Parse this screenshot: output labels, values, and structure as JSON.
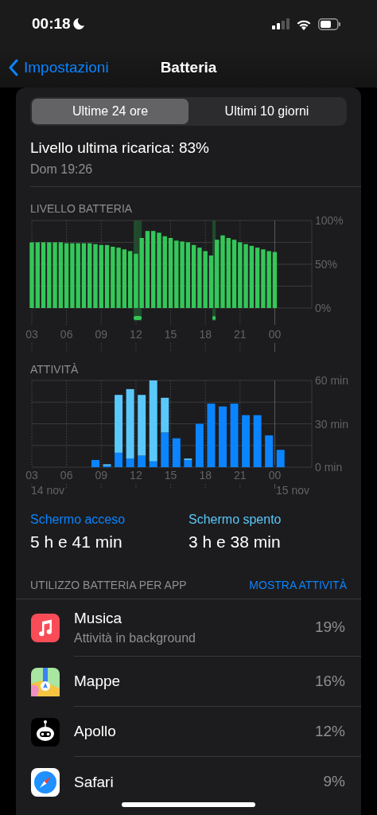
{
  "status_bar": {
    "time": "00:18",
    "focus_moon": true
  },
  "nav": {
    "back_label": "Impostazioni",
    "title": "Batteria"
  },
  "tabs": [
    {
      "label": "Ultime 24 ore",
      "selected": true
    },
    {
      "label": "Ultimi 10 giorni",
      "selected": false
    }
  ],
  "last_charge": {
    "text": "Livello ultima ricarica: 83%",
    "time": "Dom 19:26"
  },
  "battery_level": {
    "title": "LIVELLO BATTERIA",
    "chart_data": {
      "type": "bar",
      "x": [
        3,
        3.5,
        4,
        4.5,
        5,
        5.5,
        6,
        6.5,
        7,
        7.5,
        8,
        8.5,
        9,
        9.5,
        10,
        10.5,
        11,
        11.5,
        12,
        12.5,
        13,
        13.5,
        14,
        14.5,
        15,
        15.5,
        16,
        16.5,
        17,
        17.5,
        18,
        18.5,
        19,
        19.5,
        20,
        20.5,
        21,
        21.5,
        22,
        22.5,
        23,
        23.5,
        24
      ],
      "values": [
        75,
        75,
        75,
        75,
        75,
        75,
        74,
        74,
        74,
        74,
        74,
        73,
        72,
        72,
        70,
        69,
        67,
        65,
        62,
        80,
        88,
        88,
        86,
        82,
        80,
        77,
        76,
        75,
        72,
        69,
        65,
        60,
        78,
        83,
        80,
        78,
        75,
        73,
        71,
        69,
        67,
        65,
        64
      ],
      "color": "#34c759",
      "grid": true,
      "xlim": [
        3,
        27.2
      ],
      "ylim": [
        0,
        100
      ],
      "xticks": [
        {
          "value": 3,
          "label": "03"
        },
        {
          "value": 6,
          "label": "06"
        },
        {
          "value": 9,
          "label": "09"
        },
        {
          "value": 12,
          "label": "12"
        },
        {
          "value": 15,
          "label": "15"
        },
        {
          "value": 18,
          "label": "18"
        },
        {
          "value": 21,
          "label": "21"
        }
      ],
      "yticks": [
        {
          "value": 100,
          "label": "100%"
        },
        {
          "value": 50,
          "label": "50%"
        },
        {
          "value": 0,
          "label": "0%"
        }
      ],
      "bands": [
        {
          "axis": "x",
          "from": 11.8,
          "to": 12.5
        },
        {
          "axis": "x",
          "from": 18.6,
          "to": 18.9
        }
      ],
      "ref_lines": [
        {
          "axis": "x",
          "value": 24
        }
      ]
    },
    "midnight_label": "00"
  },
  "activity": {
    "title": "ATTIVITÀ",
    "chart_data": {
      "type": "bar",
      "stacked": true,
      "grid": true,
      "x": [
        8.5,
        9.5,
        10.5,
        11.5,
        12.5,
        13.5,
        14.5,
        15.5,
        16.5,
        17.5,
        18.5,
        19.5,
        20.5,
        21.5,
        22.5,
        23.5,
        24.5
      ],
      "series": [
        {
          "name": "Schermo acceso",
          "color": "#0a84ff",
          "values": [
            5,
            1,
            10,
            6,
            8,
            4,
            24,
            20,
            5,
            30,
            44,
            42,
            44,
            36,
            36,
            22,
            12
          ]
        },
        {
          "name": "Schermo spento",
          "color": "#5ac8fa",
          "values": [
            0,
            1,
            40,
            48,
            42,
            56,
            24,
            0,
            1,
            0,
            0,
            0,
            0,
            0,
            0,
            0,
            0
          ]
        }
      ],
      "xlim": [
        3,
        27.2
      ],
      "ylim": [
        0,
        60
      ],
      "xticks": [
        {
          "value": 3,
          "label": "03"
        },
        {
          "value": 6,
          "label": "06"
        },
        {
          "value": 9,
          "label": "09"
        },
        {
          "value": 12,
          "label": "12"
        },
        {
          "value": 15,
          "label": "15"
        },
        {
          "value": 18,
          "label": "18"
        },
        {
          "value": 21,
          "label": "21"
        }
      ],
      "yticks": [
        {
          "value": 60,
          "label": "60 min"
        },
        {
          "value": 30,
          "label": "30 min"
        },
        {
          "value": 0,
          "label": "0 min"
        }
      ],
      "ref_lines": [
        {
          "axis": "x",
          "value": 24
        }
      ]
    },
    "midnight_label": "00",
    "date_labels": [
      "14 nov",
      "15 nov"
    ]
  },
  "summary": [
    {
      "value": "5 h e 41 min"
    },
    {
      "value": "3 h e 38 min"
    }
  ],
  "app_usage": {
    "title": "UTILIZZO BATTERIA PER APP",
    "action": "MOSTRA ATTIVITÀ",
    "apps": [
      {
        "kind": "music",
        "name": "Musica",
        "detail": "Attività in background",
        "percent": "19%"
      },
      {
        "kind": "maps",
        "name": "Mappe",
        "percent": "16%"
      },
      {
        "kind": "apollo",
        "name": "Apollo",
        "percent": "12%"
      },
      {
        "kind": "safari",
        "name": "Safari",
        "percent": "9%"
      }
    ]
  }
}
